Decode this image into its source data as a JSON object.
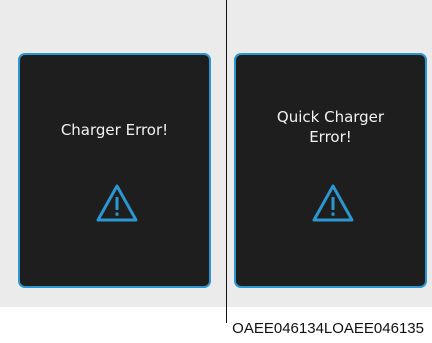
{
  "screens": [
    {
      "lines": [
        "Charger Error!"
      ],
      "icon": "warning-triangle-icon"
    },
    {
      "lines": [
        "Quick Charger",
        "Error!"
      ],
      "icon": "warning-triangle-icon"
    }
  ],
  "caption": "OAEE046134LOAEE046135",
  "colors": {
    "accent": "#2b96cf",
    "screen_bg": "#1e1e1e",
    "text": "#f2f2f2",
    "backdrop": "#ebebeb"
  }
}
